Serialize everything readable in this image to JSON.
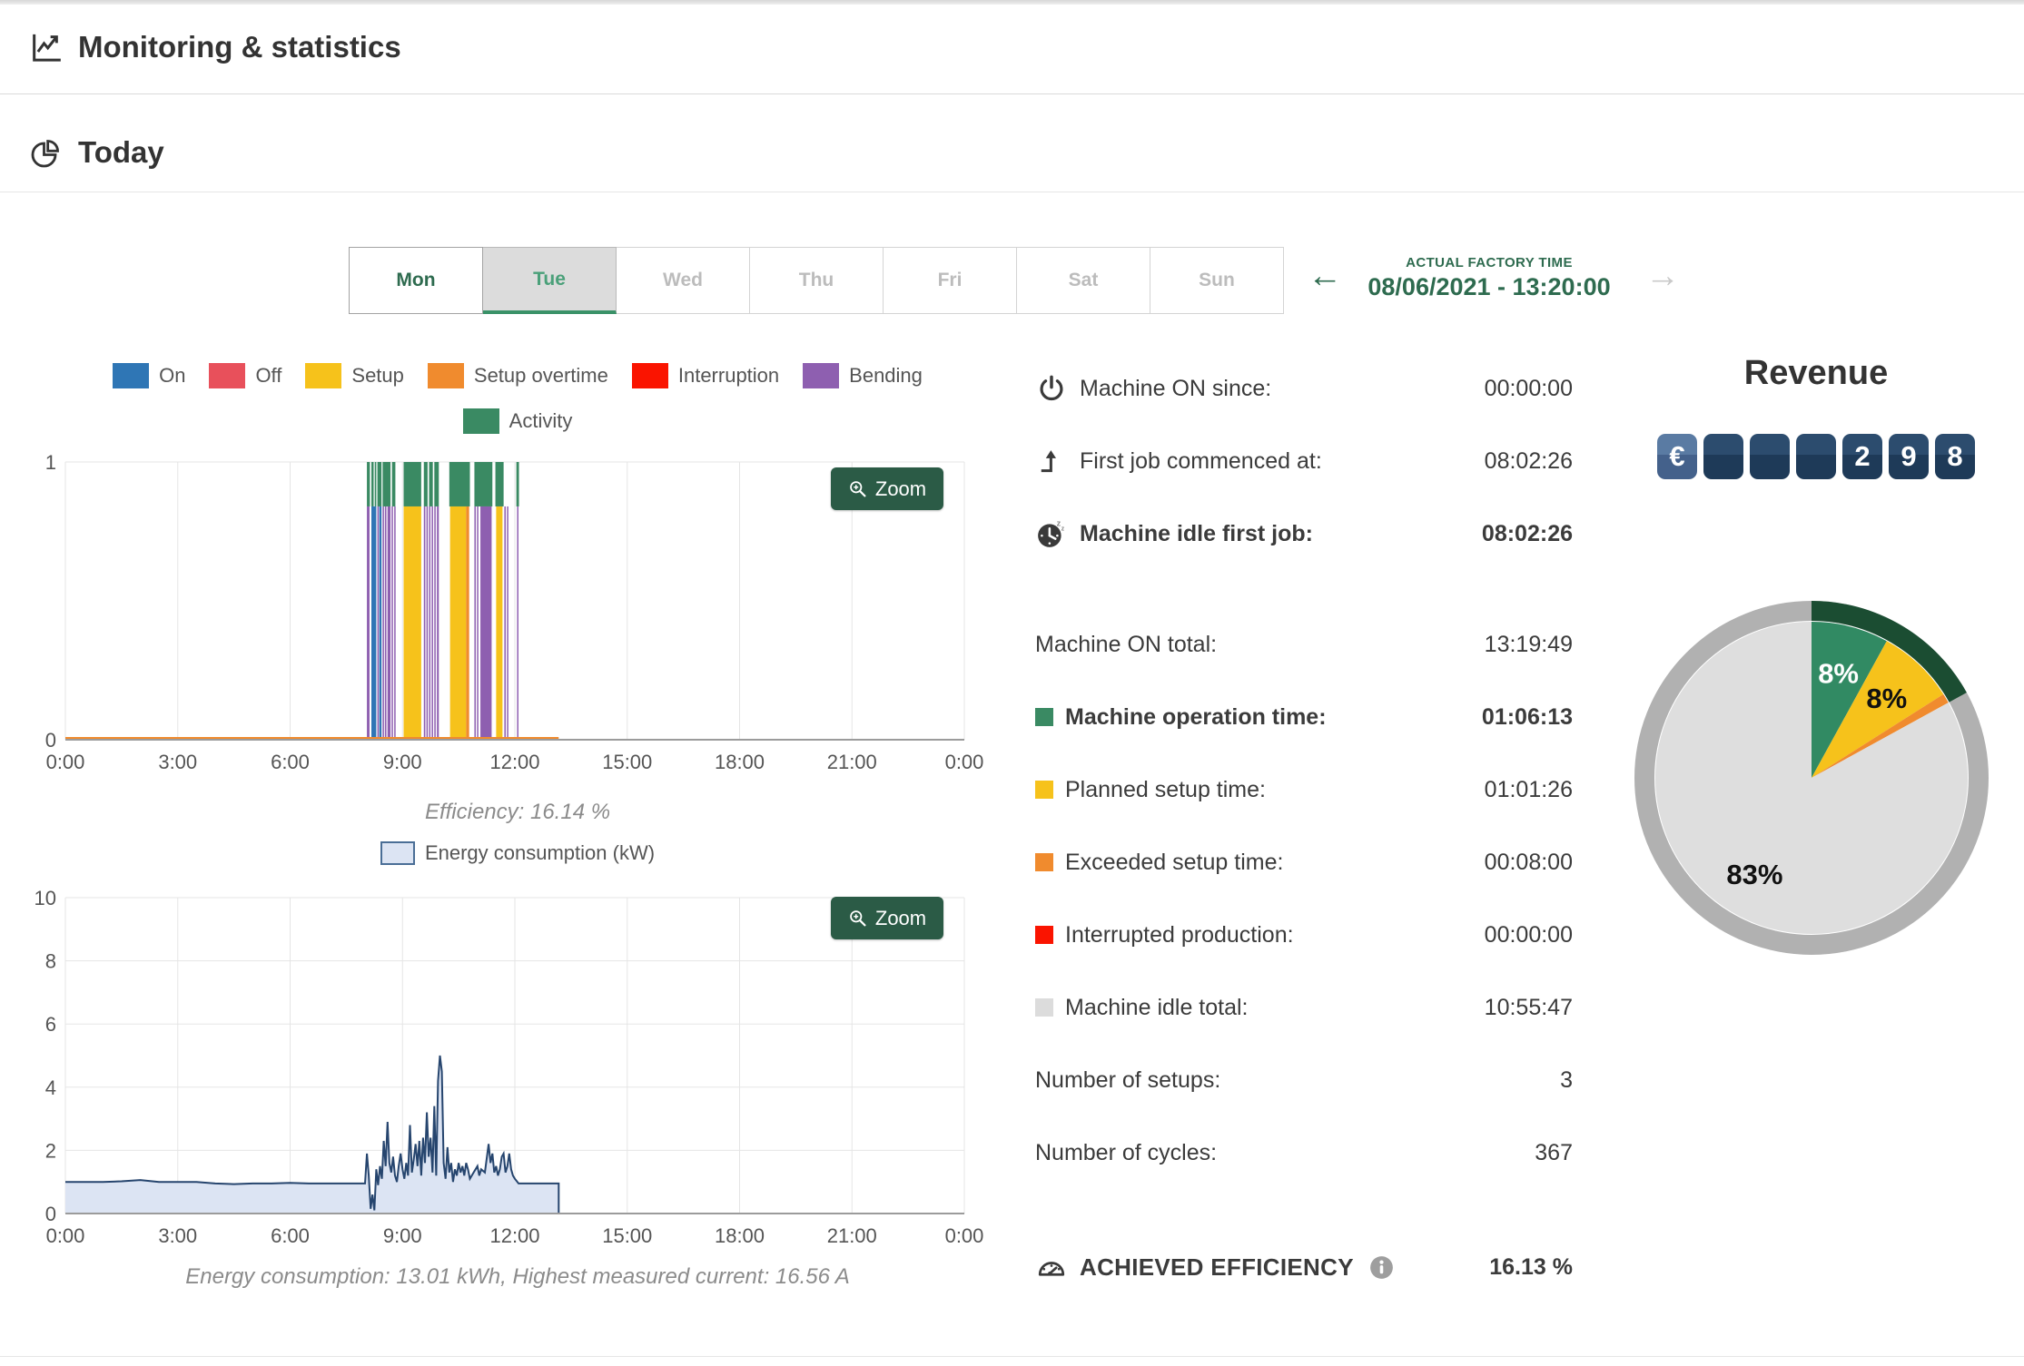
{
  "page": {
    "title": "Monitoring & statistics",
    "section": "Today"
  },
  "tabs": {
    "days": [
      {
        "label": "Mon"
      },
      {
        "label": "Tue"
      },
      {
        "label": "Wed"
      },
      {
        "label": "Thu"
      },
      {
        "label": "Fri"
      },
      {
        "label": "Sat"
      },
      {
        "label": "Sun"
      }
    ]
  },
  "factory_time": {
    "label": "ACTUAL FACTORY TIME",
    "value": "08/06/2021 - 13:20:00",
    "prev_arrow": "←",
    "next_arrow": "→"
  },
  "legend": {
    "items": [
      {
        "label": "On",
        "key": "on"
      },
      {
        "label": "Off",
        "key": "off"
      },
      {
        "label": "Setup",
        "key": "setup"
      },
      {
        "label": "Setup overtime",
        "key": "setup_overtime"
      },
      {
        "label": "Interruption",
        "key": "interruption"
      },
      {
        "label": "Bending",
        "key": "bending"
      }
    ],
    "activity_item": {
      "label": "Activity",
      "key": "activity"
    }
  },
  "zoom_button": {
    "label": "Zoom"
  },
  "colors": {
    "on": "#2f76b5",
    "off": "#e8505b",
    "setup": "#f6c21b",
    "setup_overtime": "#f08b2e",
    "interruption": "#fa1400",
    "bending": "#8e5fb0",
    "activity": "#3a8a63",
    "idle": "#dcdcdc",
    "energy_fill": "#dce4f3",
    "energy_line": "#26456e",
    "energy_border": "#4a6e96",
    "pie_operation": "#318a63",
    "pie_setup": "#f6c21b",
    "pie_exceeded": "#f08b2e",
    "pie_idle": "#dedede",
    "pie_ring": "#b1b1b1",
    "pie_ring_highlight": "#1b4d32",
    "zoom_button_bg": "#2b5b46",
    "accent_green": "#2e6b4f"
  },
  "chart_data": [
    {
      "id": "activity-timeline",
      "type": "bar",
      "x_ticks": [
        "0:00",
        "3:00",
        "6:00",
        "9:00",
        "12:00",
        "15:00",
        "18:00",
        "21:00",
        "0:00"
      ],
      "x_range_hours": [
        0,
        24
      ],
      "ylim": [
        0,
        1
      ],
      "y_ticks": [
        "1",
        "0"
      ],
      "bar_top": 0.84,
      "segments": [
        {
          "start": 8.05,
          "end": 8.12,
          "series": "bending"
        },
        {
          "start": 8.17,
          "end": 8.3,
          "series": "on"
        },
        {
          "start": 8.33,
          "end": 8.36,
          "series": "bending"
        },
        {
          "start": 8.38,
          "end": 8.44,
          "series": "on"
        },
        {
          "start": 8.47,
          "end": 8.5,
          "series": "bending"
        },
        {
          "start": 8.53,
          "end": 8.57,
          "series": "bending"
        },
        {
          "start": 8.6,
          "end": 8.68,
          "series": "bending"
        },
        {
          "start": 8.71,
          "end": 8.74,
          "series": "bending"
        },
        {
          "start": 8.78,
          "end": 8.81,
          "series": "bending"
        },
        {
          "start": 9.03,
          "end": 9.5,
          "series": "setup"
        },
        {
          "start": 9.57,
          "end": 9.61,
          "series": "bending"
        },
        {
          "start": 9.64,
          "end": 9.67,
          "series": "bending"
        },
        {
          "start": 9.71,
          "end": 9.74,
          "series": "bending"
        },
        {
          "start": 9.78,
          "end": 9.81,
          "series": "bending"
        },
        {
          "start": 9.85,
          "end": 9.88,
          "series": "bending"
        },
        {
          "start": 9.92,
          "end": 9.97,
          "series": "bending"
        },
        {
          "start": 10.27,
          "end": 10.7,
          "series": "setup"
        },
        {
          "start": 10.7,
          "end": 10.78,
          "series": "setup_overtime"
        },
        {
          "start": 10.92,
          "end": 10.95,
          "series": "bending"
        },
        {
          "start": 10.99,
          "end": 11.02,
          "series": "bending"
        },
        {
          "start": 11.08,
          "end": 11.38,
          "series": "bending"
        },
        {
          "start": 11.5,
          "end": 11.67,
          "series": "setup"
        },
        {
          "start": 11.72,
          "end": 11.75,
          "series": "bending"
        },
        {
          "start": 11.79,
          "end": 11.82,
          "series": "bending"
        },
        {
          "start": 12.06,
          "end": 12.09,
          "series": "bending"
        }
      ],
      "activity_band": [
        [
          8.05,
          8.13
        ],
        [
          8.17,
          8.23
        ],
        [
          8.26,
          8.3
        ],
        [
          8.33,
          8.44
        ],
        [
          8.47,
          8.68
        ],
        [
          8.72,
          8.81
        ],
        [
          9.03,
          9.5
        ],
        [
          9.57,
          9.67
        ],
        [
          9.71,
          9.81
        ],
        [
          9.85,
          9.97
        ],
        [
          10.25,
          10.8
        ],
        [
          10.92,
          11.4
        ],
        [
          11.48,
          11.7
        ],
        [
          12.04,
          12.11
        ]
      ],
      "baseline": {
        "series": "setup_overtime",
        "start": 0,
        "end": 13.17
      },
      "caption": "Efficiency: 16.14 %"
    },
    {
      "id": "energy-consumption",
      "type": "area",
      "legend": "Energy consumption (kW)",
      "x_ticks": [
        "0:00",
        "3:00",
        "6:00",
        "9:00",
        "12:00",
        "15:00",
        "18:00",
        "21:00",
        "0:00"
      ],
      "x_range_hours": [
        0,
        24
      ],
      "ylim": [
        0,
        10
      ],
      "y_ticks": [
        0,
        2,
        4,
        6,
        8,
        10
      ],
      "points": [
        [
          0,
          1.0
        ],
        [
          0.5,
          1.0
        ],
        [
          1,
          1.0
        ],
        [
          1.5,
          1.02
        ],
        [
          2,
          1.06
        ],
        [
          2.5,
          1.0
        ],
        [
          3,
          1.0
        ],
        [
          3.5,
          1.0
        ],
        [
          4,
          0.95
        ],
        [
          4.5,
          0.93
        ],
        [
          5,
          0.95
        ],
        [
          5.5,
          0.95
        ],
        [
          6,
          0.97
        ],
        [
          6.5,
          0.95
        ],
        [
          7,
          0.95
        ],
        [
          7.5,
          0.95
        ],
        [
          8.0,
          0.95
        ],
        [
          8.05,
          1.9
        ],
        [
          8.1,
          1.2
        ],
        [
          8.15,
          0.15
        ],
        [
          8.2,
          0.6
        ],
        [
          8.25,
          0.1
        ],
        [
          8.3,
          1.4
        ],
        [
          8.35,
          0.9
        ],
        [
          8.4,
          1.5
        ],
        [
          8.45,
          1.1
        ],
        [
          8.5,
          2.3
        ],
        [
          8.55,
          1.5
        ],
        [
          8.6,
          2.9
        ],
        [
          8.65,
          1.6
        ],
        [
          8.7,
          1.3
        ],
        [
          8.75,
          1.8
        ],
        [
          8.8,
          1.2
        ],
        [
          8.85,
          1.0
        ],
        [
          8.9,
          1.5
        ],
        [
          8.95,
          1.9
        ],
        [
          9.0,
          1.4
        ],
        [
          9.05,
          1.1
        ],
        [
          9.1,
          1.6
        ],
        [
          9.15,
          1.2
        ],
        [
          9.2,
          2.8
        ],
        [
          9.25,
          1.3
        ],
        [
          9.3,
          1.7
        ],
        [
          9.35,
          2.2
        ],
        [
          9.4,
          1.5
        ],
        [
          9.45,
          2.3
        ],
        [
          9.5,
          1.2
        ],
        [
          9.55,
          2.4
        ],
        [
          9.6,
          1.6
        ],
        [
          9.65,
          3.2
        ],
        [
          9.7,
          1.8
        ],
        [
          9.75,
          2.4
        ],
        [
          9.8,
          1.3
        ],
        [
          9.85,
          3.4
        ],
        [
          9.9,
          1.2
        ],
        [
          9.95,
          4.2
        ],
        [
          10.0,
          5.0
        ],
        [
          10.05,
          4.5
        ],
        [
          10.1,
          1.6
        ],
        [
          10.15,
          1.1
        ],
        [
          10.2,
          2.1
        ],
        [
          10.25,
          1.3
        ],
        [
          10.3,
          1.6
        ],
        [
          10.35,
          1.0
        ],
        [
          10.4,
          1.4
        ],
        [
          10.45,
          1.2
        ],
        [
          10.5,
          1.6
        ],
        [
          10.55,
          1.3
        ],
        [
          10.6,
          1.5
        ],
        [
          10.65,
          1.2
        ],
        [
          10.7,
          1.6
        ],
        [
          10.75,
          1.4
        ],
        [
          10.8,
          1.1
        ],
        [
          10.9,
          1.3
        ],
        [
          11.0,
          1.5
        ],
        [
          11.05,
          1.2
        ],
        [
          11.1,
          1.4
        ],
        [
          11.2,
          1.3
        ],
        [
          11.3,
          2.2
        ],
        [
          11.35,
          1.6
        ],
        [
          11.4,
          1.9
        ],
        [
          11.45,
          1.3
        ],
        [
          11.5,
          1.5
        ],
        [
          11.55,
          1.2
        ],
        [
          11.6,
          1.4
        ],
        [
          11.65,
          1.8
        ],
        [
          11.7,
          1.9
        ],
        [
          11.75,
          1.3
        ],
        [
          11.8,
          1.5
        ],
        [
          11.85,
          1.9
        ],
        [
          11.9,
          1.4
        ],
        [
          11.95,
          1.2
        ],
        [
          12.0,
          1.1
        ],
        [
          12.1,
          0.95
        ],
        [
          12.5,
          0.95
        ],
        [
          13.0,
          0.95
        ],
        [
          13.17,
          0.95
        ],
        [
          13.17,
          0
        ]
      ],
      "caption": "Energy consumption: 13.01 kWh, Highest measured current: 16.56 A"
    },
    {
      "id": "revenue-pie",
      "type": "pie",
      "title": "Revenue",
      "slices": [
        {
          "label": "8%",
          "value": 8,
          "color_key": "pie_operation",
          "label_color": "#ffffff"
        },
        {
          "label": "8%",
          "value": 8,
          "color_key": "pie_setup",
          "label_color": "#111111"
        },
        {
          "label": "",
          "value": 1,
          "color_key": "pie_exceeded",
          "label_color": "#111111"
        },
        {
          "label": "83%",
          "value": 83,
          "color_key": "pie_idle",
          "label_color": "#111111"
        }
      ],
      "ring": {
        "color_key": "pie_ring",
        "highlight_color_key": "pie_ring_highlight",
        "highlight_values": 17
      }
    }
  ],
  "stats": {
    "rows": [
      {
        "label": "Machine ON since:",
        "value": "00:00:00"
      },
      {
        "label": "First job commenced at:",
        "value": "08:02:26"
      },
      {
        "label": "Machine idle first job:",
        "value": "08:02:26"
      },
      {
        "label": "Machine ON total:",
        "value": "13:19:49"
      },
      {
        "label": "Machine operation time:",
        "value": "01:06:13",
        "swatch": "activity"
      },
      {
        "label": "Planned setup time:",
        "value": "01:01:26",
        "swatch": "setup"
      },
      {
        "label": "Exceeded setup time:",
        "value": "00:08:00",
        "swatch": "setup_overtime"
      },
      {
        "label": "Interrupted production:",
        "value": "00:00:00",
        "swatch": "interruption"
      },
      {
        "label": "Machine idle total:",
        "value": "10:55:47",
        "swatch": "idle"
      },
      {
        "label": "Number of setups:",
        "value": "3"
      },
      {
        "label": "Number of cycles:",
        "value": "367"
      },
      {
        "label": "ACHIEVED EFFICIENCY",
        "value": "16.13 %"
      }
    ]
  },
  "revenue": {
    "title": "Revenue",
    "tiles": [
      "€",
      "",
      "",
      "",
      "2",
      "9",
      "8"
    ]
  }
}
